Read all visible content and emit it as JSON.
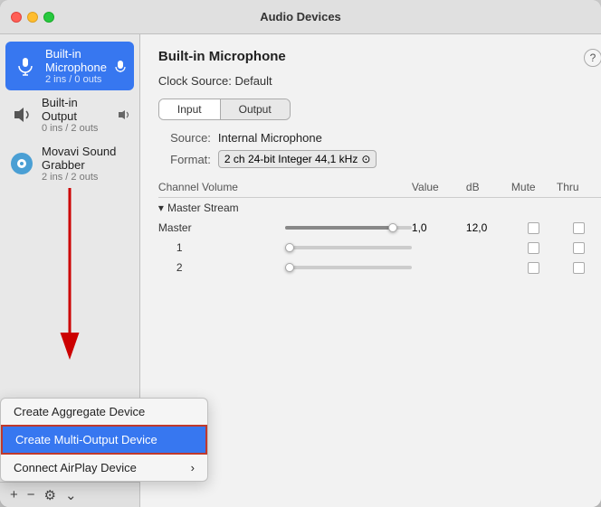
{
  "window": {
    "title": "Audio Devices"
  },
  "sidebar": {
    "devices": [
      {
        "id": "builtin-mic",
        "name": "Built-in Microphone",
        "sub": "2 ins / 0 outs",
        "selected": true,
        "icon": "mic"
      },
      {
        "id": "builtin-output",
        "name": "Built-in Output",
        "sub": "0 ins / 2 outs",
        "selected": false,
        "icon": "speaker"
      },
      {
        "id": "movavi",
        "name": "Movavi Sound Grabber",
        "sub": "2 ins / 2 outs",
        "selected": false,
        "icon": "movavi"
      }
    ],
    "toolbar": {
      "add": "+",
      "remove": "−",
      "settings": "⚙",
      "dropdown": "⌄"
    }
  },
  "dropdown": {
    "items": [
      {
        "id": "aggregate",
        "label": "Create Aggregate Device",
        "highlighted": false
      },
      {
        "id": "multi-output",
        "label": "Create Multi-Output Device",
        "highlighted": true
      },
      {
        "id": "airplay",
        "label": "Connect AirPlay Device",
        "highlighted": false,
        "hasArrow": true
      }
    ]
  },
  "detail": {
    "title": "Built-in Microphone",
    "help": "?",
    "clock_source_label": "Clock Source:",
    "clock_source_value": "Default",
    "tabs": [
      {
        "id": "input",
        "label": "Input",
        "active": true
      },
      {
        "id": "output",
        "label": "Output",
        "active": false
      }
    ],
    "source_label": "Source:",
    "source_value": "Internal Microphone",
    "format_label": "Format:",
    "format_value": "2 ch 24-bit Integer 44,1 kHz",
    "table": {
      "headers": [
        "Channel Volume",
        "",
        "Value",
        "dB",
        "Mute",
        "Thru"
      ],
      "sections": [
        {
          "label": "Master Stream",
          "rows": [
            {
              "label": "Master",
              "slider_pct": 85,
              "value": "1,0",
              "db": "12,0"
            },
            {
              "label": "1",
              "slider_pct": 0,
              "value": "",
              "db": ""
            },
            {
              "label": "2",
              "slider_pct": 0,
              "value": "",
              "db": ""
            }
          ]
        }
      ]
    }
  },
  "icons": {
    "mic": "🎤",
    "speaker": "🔊",
    "movavi": "🎵",
    "chevron": "▸",
    "down_chevron": "▾",
    "arrow_sub": "⬇"
  }
}
